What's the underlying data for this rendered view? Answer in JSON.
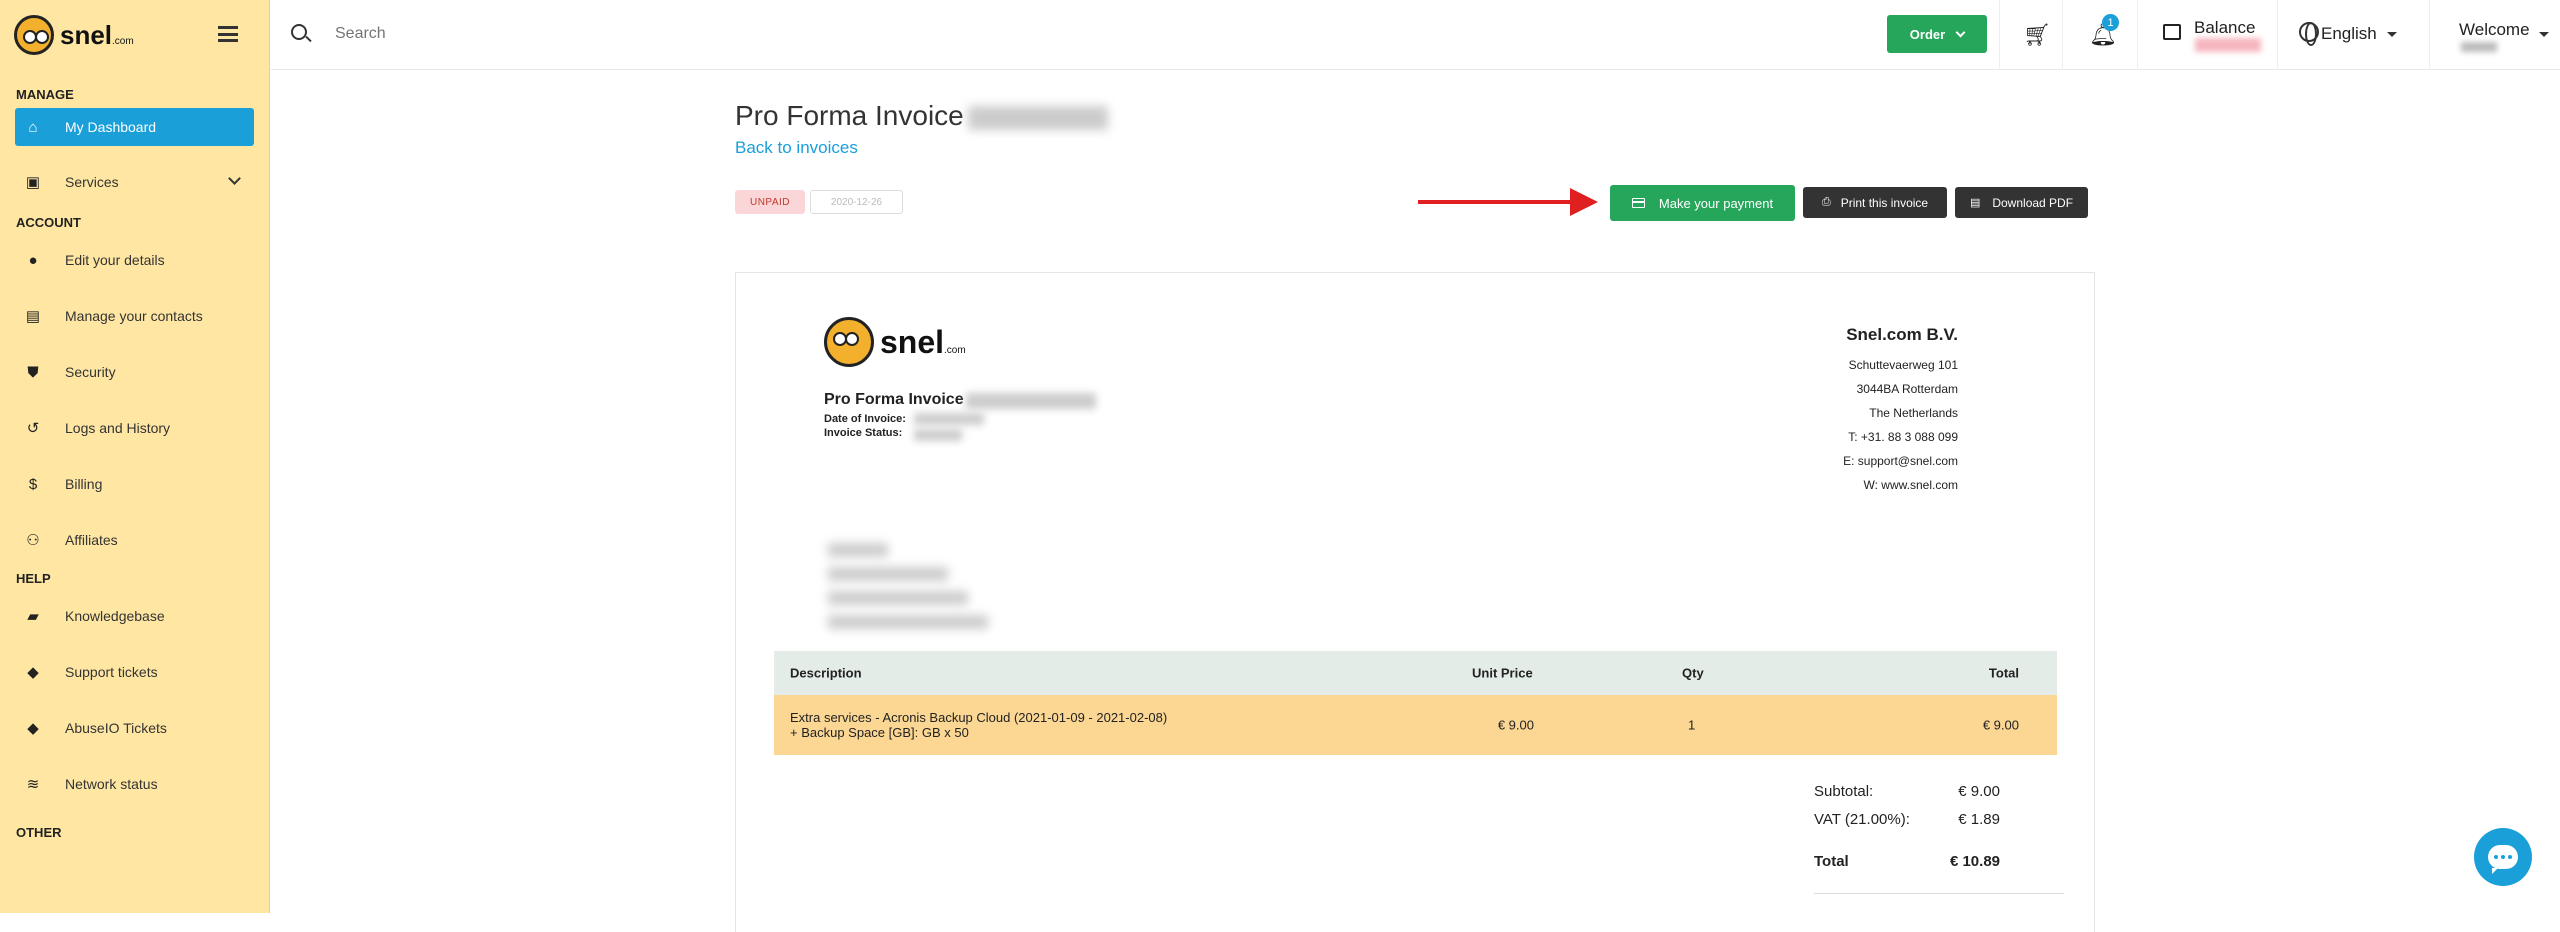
{
  "sidebar": {
    "logo_text": "snel",
    "logo_suffix": ".com",
    "sections": {
      "manage": "MANAGE",
      "account": "ACCOUNT",
      "help": "HELP",
      "other": "OTHER"
    },
    "items": {
      "dashboard": "My Dashboard",
      "services": "Services",
      "edit_details": "Edit your details",
      "contacts": "Manage your contacts",
      "security": "Security",
      "logs": "Logs and History",
      "billing": "Billing",
      "affiliates": "Affiliates",
      "knowledgebase": "Knowledgebase",
      "support": "Support tickets",
      "abuseio": "AbuseIO Tickets",
      "network": "Network status"
    }
  },
  "topbar": {
    "search_placeholder": "Search",
    "order_label": "Order",
    "notification_count": "1",
    "balance_label": "Balance",
    "language": "English",
    "welcome": "Welcome"
  },
  "invoice_page": {
    "title": "Pro Forma Invoice",
    "back_link": "Back to invoices",
    "status_badge": "UNPAID",
    "date_badge": "2020-12-26",
    "pay_button": "Make your payment",
    "print_button": "Print this invoice",
    "pdf_button": "Download PDF"
  },
  "invoice": {
    "logo_text": "snel",
    "logo_suffix": ".com",
    "title": "Pro Forma Invoice",
    "date_label": "Date of Invoice:",
    "status_label": "Invoice Status:",
    "company": {
      "name": "Snel.com B.V.",
      "street": "Schuttevaerweg 101",
      "city": "3044BA Rotterdam",
      "country": "The Netherlands",
      "phone": "T: +31. 88 3 088 099",
      "email": "E: support@snel.com",
      "web": "W: www.snel.com"
    },
    "table": {
      "headers": {
        "description": "Description",
        "unit_price": "Unit Price",
        "qty": "Qty",
        "total": "Total"
      },
      "rows": [
        {
          "description_line1": "Extra services - Acronis Backup Cloud (2021-01-09 - 2021-02-08)",
          "description_line2": "+ Backup Space [GB]: GB x 50",
          "unit_price": "€ 9.00",
          "qty": "1",
          "total": "€ 9.00"
        }
      ]
    },
    "totals": {
      "subtotal_label": "Subtotal:",
      "subtotal": "€ 9.00",
      "vat_label": "VAT (21.00%):",
      "vat": "€ 1.89",
      "total_label": "Total",
      "total": "€ 10.89"
    }
  },
  "colors": {
    "sidebar_bg": "#ffe7a3",
    "accent_blue": "#1a9fd9",
    "green": "#26a65b",
    "row_highlight": "#fbd793",
    "arrow_red": "#e02020"
  }
}
